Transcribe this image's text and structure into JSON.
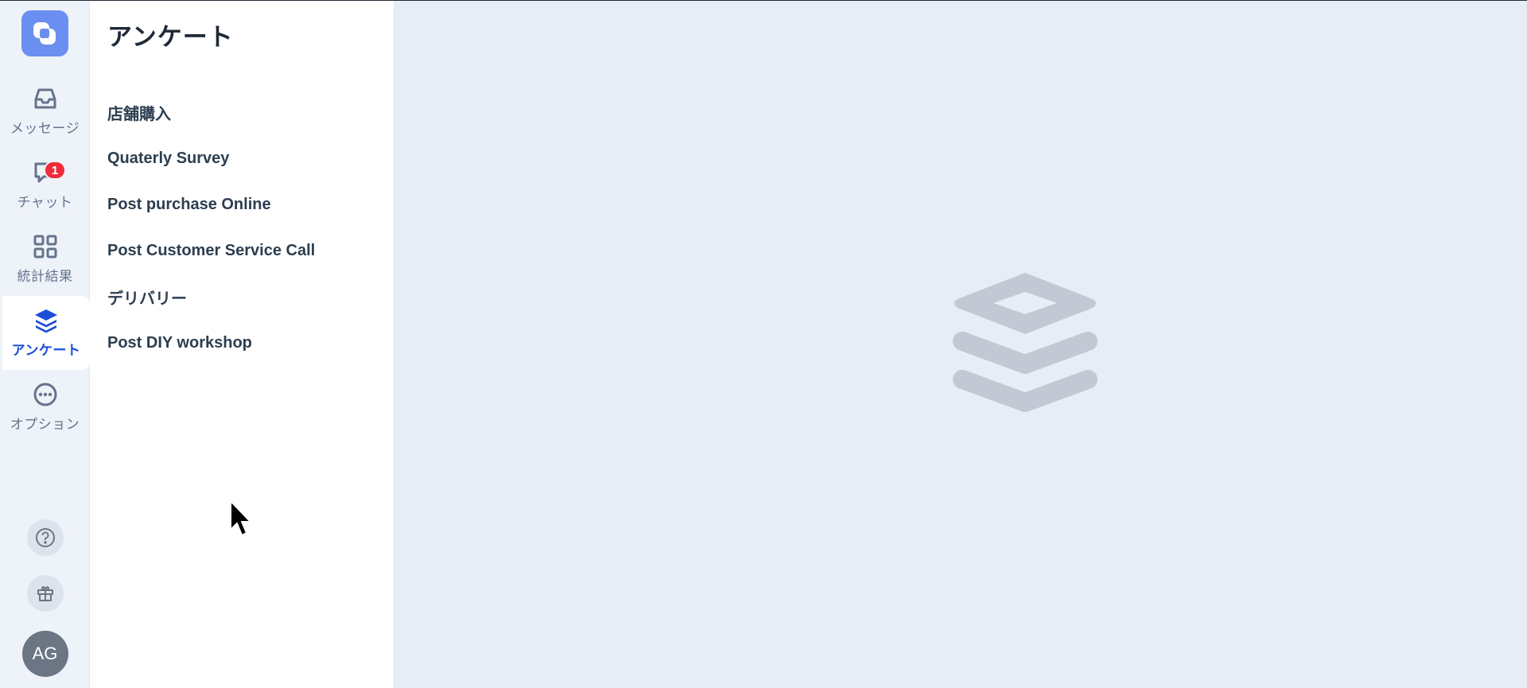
{
  "sidebar": {
    "items": [
      {
        "key": "messages",
        "label": "メッセージ",
        "icon": "inbox-icon"
      },
      {
        "key": "chat",
        "label": "チャット",
        "icon": "chat-bubble-icon",
        "badge": "1"
      },
      {
        "key": "stats",
        "label": "統計結果",
        "icon": "grid-icon"
      },
      {
        "key": "survey",
        "label": "アンケート",
        "icon": "layers-icon",
        "active": true
      },
      {
        "key": "options",
        "label": "オプション",
        "icon": "more-circle-icon"
      }
    ],
    "help_icon": "help-circle-icon",
    "gift_icon": "gift-icon",
    "avatar_initials": "AG"
  },
  "panel": {
    "title": "アンケート",
    "surveys": [
      "店舗購入",
      "Quaterly Survey",
      "Post purchase Online",
      "Post Customer Service Call",
      "デリバリー",
      "Post DIY workshop"
    ]
  },
  "main": {
    "placeholder_icon": "layers-icon"
  },
  "colors": {
    "accent": "#1d4ed8",
    "logo": "#6b8ff0",
    "badge": "#ef2b3a",
    "rail_bg": "#eef2f9",
    "main_bg": "#e6edf6"
  }
}
